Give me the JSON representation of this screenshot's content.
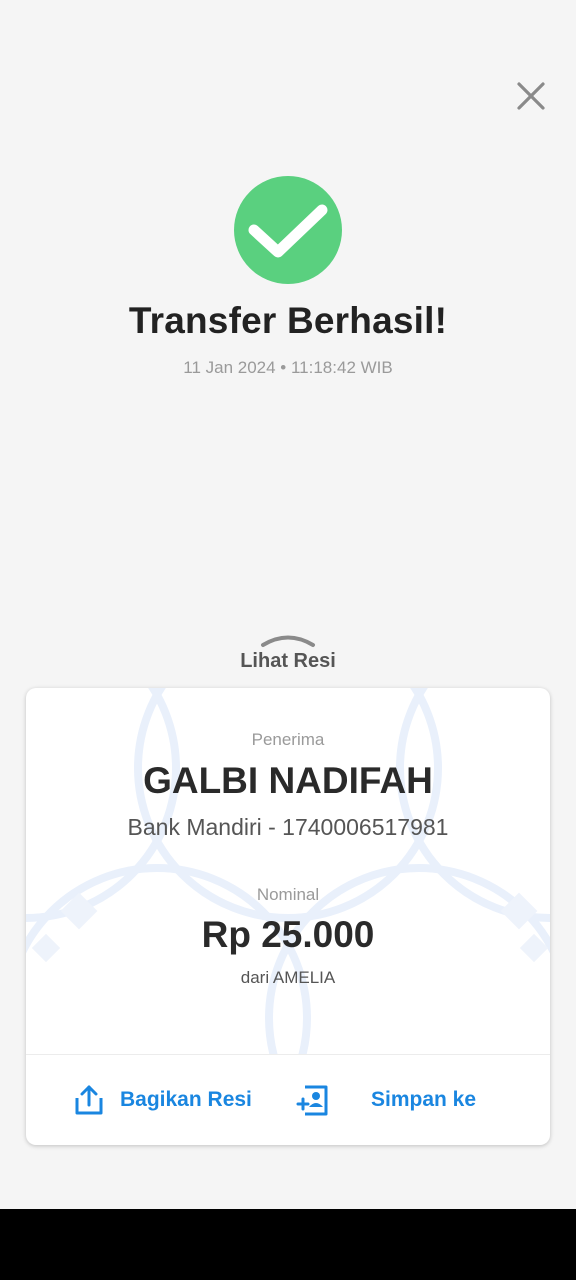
{
  "header": {
    "close_icon": "close-icon"
  },
  "status": {
    "icon": "checkmark-circle-icon",
    "color": "#5ad07f",
    "title": "Transfer Berhasil!",
    "datetime": "11 Jan 2024 • 11:18:42 WIB"
  },
  "receipt_toggle": {
    "icon": "chevron-up-icon",
    "label": "Lihat Resi"
  },
  "receipt": {
    "recipient_label": "Penerima",
    "recipient_name": "GALBI NADIFAH",
    "bank_account": "Bank Mandiri - 1740006517981",
    "amount_label": "Nominal",
    "amount": "Rp 25.000",
    "from": "dari AMELIA"
  },
  "actions": {
    "share_label": "Bagikan Resi",
    "share_icon": "share-upload-icon",
    "save_label": "Simpan ke",
    "save_icon": "add-contact-icon",
    "accent_color": "#1a86e0"
  }
}
